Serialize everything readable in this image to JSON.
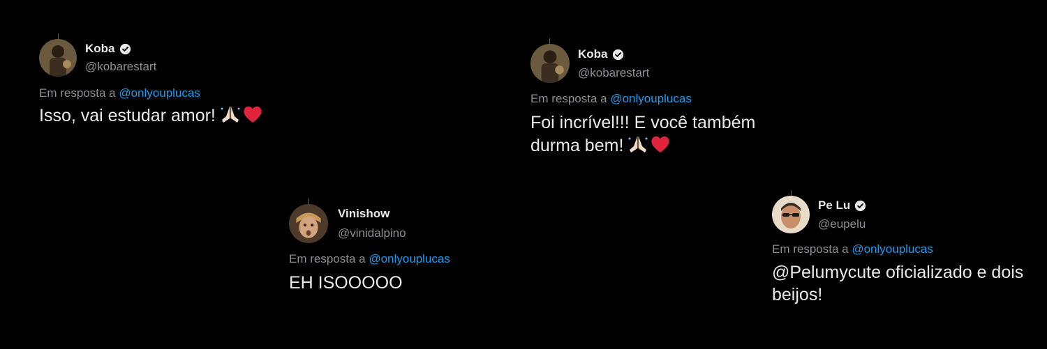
{
  "tweets": [
    {
      "name": "Koba",
      "handle": "@kobarestart",
      "reply_prefix": "Em resposta a",
      "reply_to": "@onlyouplucas",
      "text": "Isso, vai estudar amor!",
      "emojis": [
        "folded-hands",
        "red-heart"
      ]
    },
    {
      "name": "Vinishow",
      "handle": "@vinidalpino",
      "reply_prefix": "Em resposta a",
      "reply_to": "@onlyouplucas",
      "text": "EH ISOOOOO",
      "emojis": []
    },
    {
      "name": "Koba",
      "handle": "@kobarestart",
      "reply_prefix": "Em resposta a",
      "reply_to": "@onlyouplucas",
      "text_line1": "Foi incrível!!! E você também",
      "text_line2": "durma bem!",
      "emojis": [
        "folded-hands",
        "red-heart"
      ]
    },
    {
      "name": "Pe Lu",
      "handle": "@eupelu",
      "reply_prefix": "Em resposta a",
      "reply_to": "@onlyouplucas",
      "text_line1": "@Pelumycute oficializado e dois",
      "text_line2": "beijos!",
      "emojis": []
    }
  ],
  "colors": {
    "background": "#000000",
    "text_primary": "#e7e9ea",
    "text_secondary": "#8b8f94",
    "mention": "#1d9bf0"
  }
}
